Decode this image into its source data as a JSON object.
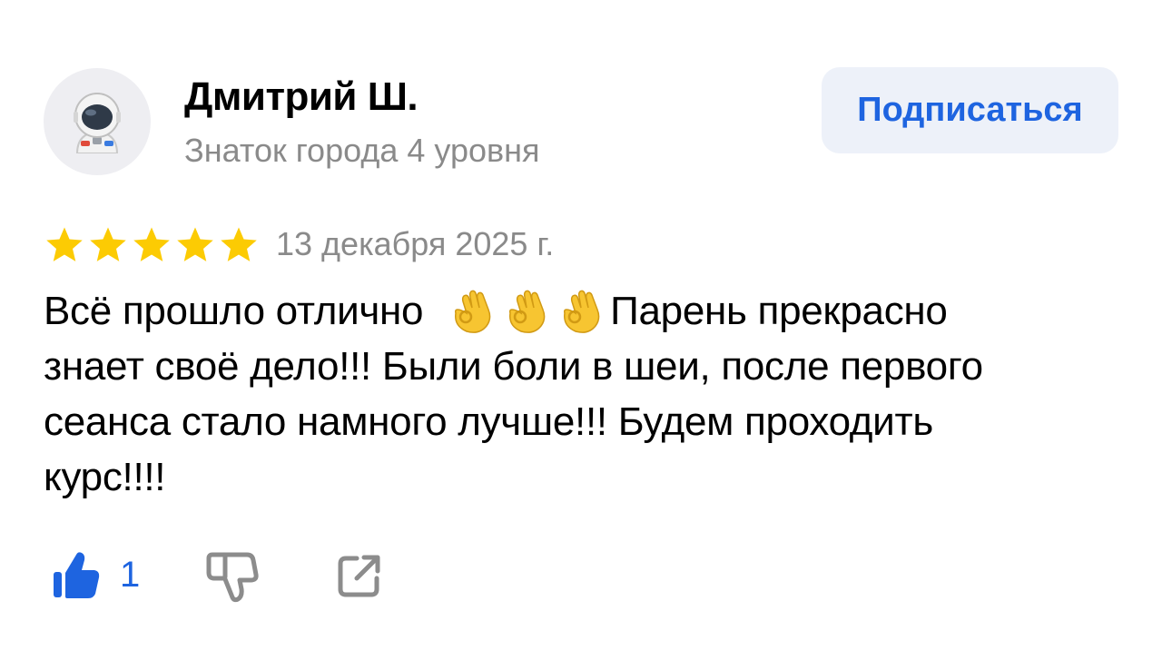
{
  "author": {
    "name": "Дмитрий Ш.",
    "level": "Знаток города 4 уровня",
    "avatar_icon": "astronaut-icon"
  },
  "subscribe_label": "Подписаться",
  "review": {
    "rating": 5,
    "rating_max": 5,
    "date": "13 декабря 2025 г.",
    "text_lines": [
      "Всё прошло отлично",
      "Парень прекрасно",
      "знает своё дело!!! Были боли в шеи, после первого",
      "сеанса стало намного лучше!!! Будем проходить",
      "курс!!!!"
    ],
    "inline_emoji": "ok-hand-icon",
    "inline_emoji_count": 3
  },
  "actions": {
    "like_count": "1",
    "like_icon": "thumbs-up-icon",
    "dislike_icon": "thumbs-down-icon",
    "share_icon": "share-icon"
  },
  "colors": {
    "accent": "#1e64e0",
    "star": "#fccb03",
    "muted_text": "#8a8a8a",
    "button_bg": "#edf1f9",
    "icon_gray": "#8c8c8c"
  }
}
